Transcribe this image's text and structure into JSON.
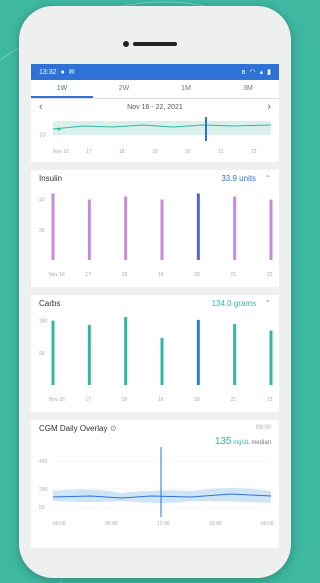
{
  "status_bar": {
    "time": "13:32",
    "left_icons": [
      "recording-icon",
      "email-icon"
    ],
    "right_icons": [
      "bluetooth-icon",
      "wifi-icon",
      "signal-icon",
      "battery-icon"
    ]
  },
  "tabs": [
    {
      "label": "1W",
      "active": true
    },
    {
      "label": "2W",
      "active": false
    },
    {
      "label": "1M",
      "active": false
    },
    {
      "label": "3M",
      "active": false
    }
  ],
  "date_range": {
    "label": "Nov 16 - 22, 2021"
  },
  "x_days": [
    "Nov 16",
    "17",
    "18",
    "19",
    "20",
    "21",
    "22"
  ],
  "glucose": {
    "y_tick": "70"
  },
  "insulin": {
    "title": "Insulin",
    "value": "33.9 units",
    "y_ticks": [
      "40",
      "20"
    ],
    "chart_data": {
      "type": "bar",
      "categories": [
        "Nov 16",
        "17",
        "18",
        "19",
        "20",
        "21",
        "22"
      ],
      "ylim": [
        0,
        45
      ],
      "values": [
        44,
        40,
        42,
        40,
        44,
        42,
        40
      ],
      "highlight_index": 4,
      "color": "#c98ad6",
      "highlight_color": "#5566cc"
    }
  },
  "carbs": {
    "title": "Carbs",
    "value": "134.0 grams",
    "y_ticks": [
      "180",
      "90"
    ],
    "chart_data": {
      "type": "bar",
      "categories": [
        "Nov 16",
        "17",
        "18",
        "19",
        "20",
        "21",
        "22"
      ],
      "ylim": [
        0,
        190
      ],
      "values": [
        180,
        168,
        190,
        132,
        182,
        170,
        152
      ],
      "highlight_index": 4,
      "color": "#2fb8a6",
      "highlight_color": "#2f7fd0"
    }
  },
  "overlay": {
    "title": "CGM Daily Overlay",
    "time": "09:00",
    "value": "135",
    "unit": "mg/dL",
    "suffix": "median",
    "y_ticks": [
      "400",
      "200",
      "50"
    ],
    "x_ticks": [
      "00:00",
      "06:00",
      "12:00",
      "18:00",
      "00:00"
    ]
  },
  "colors": {
    "accent": "#2f72d6",
    "teal": "#2fb8a6",
    "background": "#3fb8a1"
  }
}
